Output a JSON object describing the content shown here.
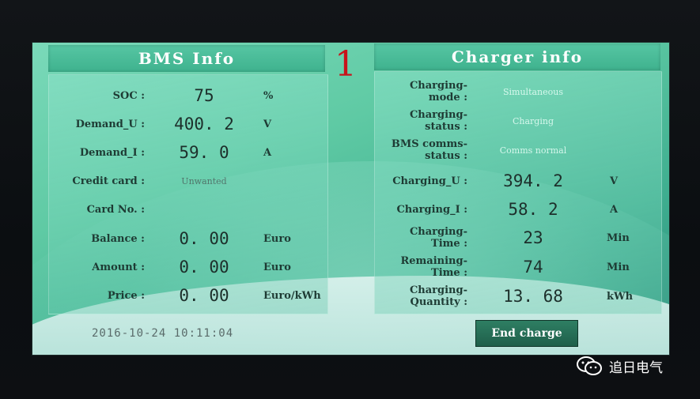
{
  "bms": {
    "title": "BMS Info",
    "rows": [
      {
        "label": "SOC :",
        "value": "75",
        "unit": "%"
      },
      {
        "label": "Demand_U :",
        "value": "400. 2",
        "unit": "V"
      },
      {
        "label": "Demand_I :",
        "value": "59. 0",
        "unit": "A"
      },
      {
        "label": "Credit card :",
        "value": "Unwanted",
        "unit": ""
      },
      {
        "label": "Card No. :",
        "value": "",
        "unit": ""
      },
      {
        "label": "Balance :",
        "value": "0. 00",
        "unit": "Euro"
      },
      {
        "label": "Amount :",
        "value": "0. 00",
        "unit": "Euro"
      },
      {
        "label": "Price :",
        "value": "0. 00",
        "unit": "Euro/kWh"
      }
    ]
  },
  "page_number": "1",
  "charger": {
    "title": "Charger info",
    "rows": [
      {
        "label1": "Charging-",
        "label2": "mode :",
        "value": "Simultaneous",
        "unit": ""
      },
      {
        "label1": "Charging-",
        "label2": "status :",
        "value": "Charging",
        "unit": ""
      },
      {
        "label1": "BMS comms-",
        "label2": "status :",
        "value": "Comms normal",
        "unit": ""
      },
      {
        "label1": "Charging_U :",
        "label2": "",
        "value": "394. 2",
        "unit": "V"
      },
      {
        "label1": "Charging_I :",
        "label2": "",
        "value": "58. 2",
        "unit": "A"
      },
      {
        "label1": "Charging-",
        "label2": "Time :",
        "value": "23",
        "unit": "Min"
      },
      {
        "label1": "Remaining-",
        "label2": "Time :",
        "value": "74",
        "unit": "Min"
      },
      {
        "label1": "Charging-",
        "label2": "Quantity :",
        "value": "13. 68",
        "unit": "kWh"
      }
    ]
  },
  "datetime": "2016-10-24   10:11:04",
  "end_charge_label": "End charge",
  "watermark_text": "追日电气",
  "icons": {
    "watermark": "wechat-icon"
  }
}
